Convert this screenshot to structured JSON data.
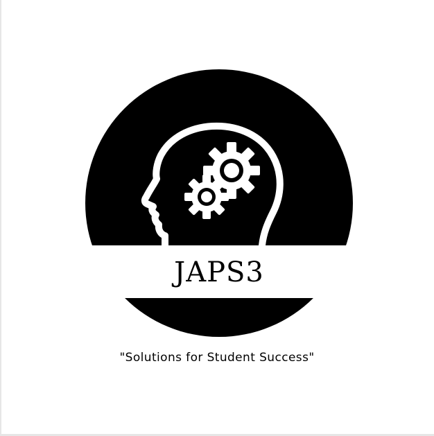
{
  "logo": {
    "brand_name": "JAPS3",
    "tagline": "\"Solutions for Student Success\"",
    "icon": "head-with-gears-icon",
    "colors": {
      "background": "#ffffff",
      "circle": "#000000",
      "band": "#ffffff",
      "text": "#000000"
    }
  }
}
